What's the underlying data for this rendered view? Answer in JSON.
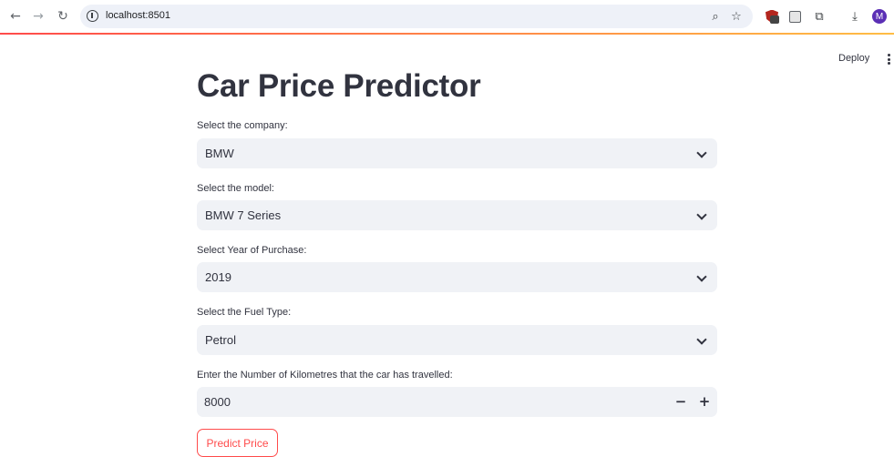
{
  "browser": {
    "url": "localhost:8501",
    "profile_initial": "M",
    "icons": [
      "back-icon",
      "forward-icon",
      "reload-icon",
      "site-info-icon",
      "zoom-icon",
      "bookmark-star-icon",
      "extension-shield-icon",
      "extension-profile-icon",
      "extensions-puzzle-icon",
      "download-icon"
    ],
    "accent_gradient": [
      "#ff4b4b",
      "#ffbd45"
    ]
  },
  "app_header": {
    "deploy_label": "Deploy",
    "menu_icon": "kebab-menu-icon"
  },
  "main": {
    "title": "Car Price Predictor",
    "company": {
      "label": "Select the company:",
      "value": "BMW"
    },
    "model": {
      "label": "Select the model:",
      "value": "BMW 7 Series"
    },
    "year": {
      "label": "Select Year of Purchase:",
      "value": "2019"
    },
    "fuel": {
      "label": "Select the Fuel Type:",
      "value": "Petrol"
    },
    "kms": {
      "label": "Enter the Number of Kilometres that the car has travelled:",
      "value": "8000",
      "decrement": "−",
      "increment": "+"
    },
    "predict_button": "Predict Price"
  },
  "colors": {
    "accent": "#ff4b4b",
    "text": "#31333f",
    "input_bg": "#f0f2f6"
  }
}
